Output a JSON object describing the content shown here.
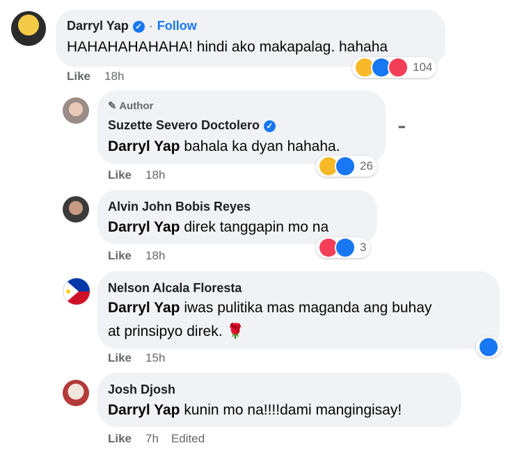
{
  "comments": [
    {
      "name": "Darryl Yap",
      "verified": true,
      "follow_label": "Follow",
      "text": "HAHAHAHAHAHA! hindi ako makapalag. hahaha",
      "like_label": "Like",
      "time": "18h",
      "reactions": [
        "haha",
        "like",
        "love"
      ],
      "reaction_count": "104"
    },
    {
      "badge": "Author",
      "name": "Suzette Severo Doctolero",
      "verified": true,
      "mention": "Darryl Yap",
      "text": " bahala ka dyan hahaha.",
      "like_label": "Like",
      "time": "18h",
      "reactions": [
        "haha",
        "like"
      ],
      "reaction_count": "26",
      "more_label": "•••"
    },
    {
      "name": "Alvin John Bobis Reyes",
      "mention": "Darryl Yap",
      "text": " direk tanggapin mo na",
      "like_label": "Like",
      "time": "18h",
      "reactions": [
        "love",
        "like"
      ],
      "reaction_count": "3"
    },
    {
      "name": "Nelson Alcala Floresta",
      "mention": "Darryl Yap",
      "text": " iwas pulitika mas maganda ang buhay",
      "text_line2": "at prinsipyo direk. 🌹",
      "like_label": "Like",
      "time": "15h",
      "reactions": [
        "like"
      ]
    },
    {
      "name": "Josh Djosh",
      "mention": "Darryl Yap",
      "text": " kunin mo na!!!!dami mangingisay!",
      "like_label": "Like",
      "time": "7h",
      "edited_label": "Edited"
    }
  ],
  "colors": {
    "bubble": "#f0f2f5",
    "like_blue": "#1877f2",
    "love_red": "#f33e58",
    "haha_yellow": "#f7b928",
    "meta_grey": "#65676b"
  }
}
